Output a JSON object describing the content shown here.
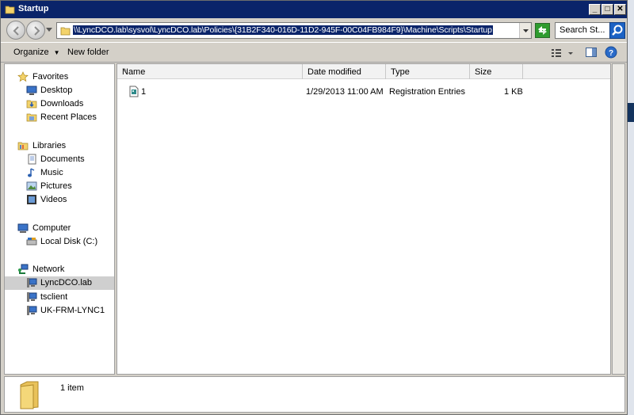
{
  "window": {
    "title": "Startup",
    "controls": {
      "minimize": "_",
      "maximize": "□",
      "close": "✕"
    }
  },
  "address": {
    "path": "\\\\LyncDCO.lab\\sysvol\\LyncDCO.lab\\Policies\\{31B2F340-016D-11D2-945F-00C04FB984F9}\\Machine\\Scripts\\Startup",
    "search_placeholder": "Search St..."
  },
  "toolbar": {
    "organize": "Organize",
    "new_folder": "New folder"
  },
  "nav": {
    "favorites": {
      "label": "Favorites",
      "items": [
        {
          "label": "Desktop",
          "icon": "desktop-icon"
        },
        {
          "label": "Downloads",
          "icon": "downloads-icon"
        },
        {
          "label": "Recent Places",
          "icon": "recent-places-icon"
        }
      ]
    },
    "libraries": {
      "label": "Libraries",
      "items": [
        {
          "label": "Documents",
          "icon": "documents-icon"
        },
        {
          "label": "Music",
          "icon": "music-icon"
        },
        {
          "label": "Pictures",
          "icon": "pictures-icon"
        },
        {
          "label": "Videos",
          "icon": "videos-icon"
        }
      ]
    },
    "computer": {
      "label": "Computer",
      "items": [
        {
          "label": "Local Disk (C:)",
          "icon": "disk-icon"
        }
      ]
    },
    "network": {
      "label": "Network",
      "items": [
        {
          "label": "LyncDCO.lab",
          "icon": "network-computer-icon",
          "selected": true
        },
        {
          "label": "tsclient",
          "icon": "network-computer-icon"
        },
        {
          "label": "UK-FRM-LYNC1",
          "icon": "network-computer-icon"
        }
      ]
    }
  },
  "columns": [
    "Name",
    "Date modified",
    "Type",
    "Size"
  ],
  "files": [
    {
      "name": "1",
      "date_modified": "1/29/2013 11:00 AM",
      "type": "Registration Entries",
      "size": "1 KB"
    }
  ],
  "details": {
    "count": "1 item"
  },
  "colors": {
    "titlebar": "#0a246a",
    "selection": "#0a246a",
    "chrome": "#d4d0c8"
  }
}
